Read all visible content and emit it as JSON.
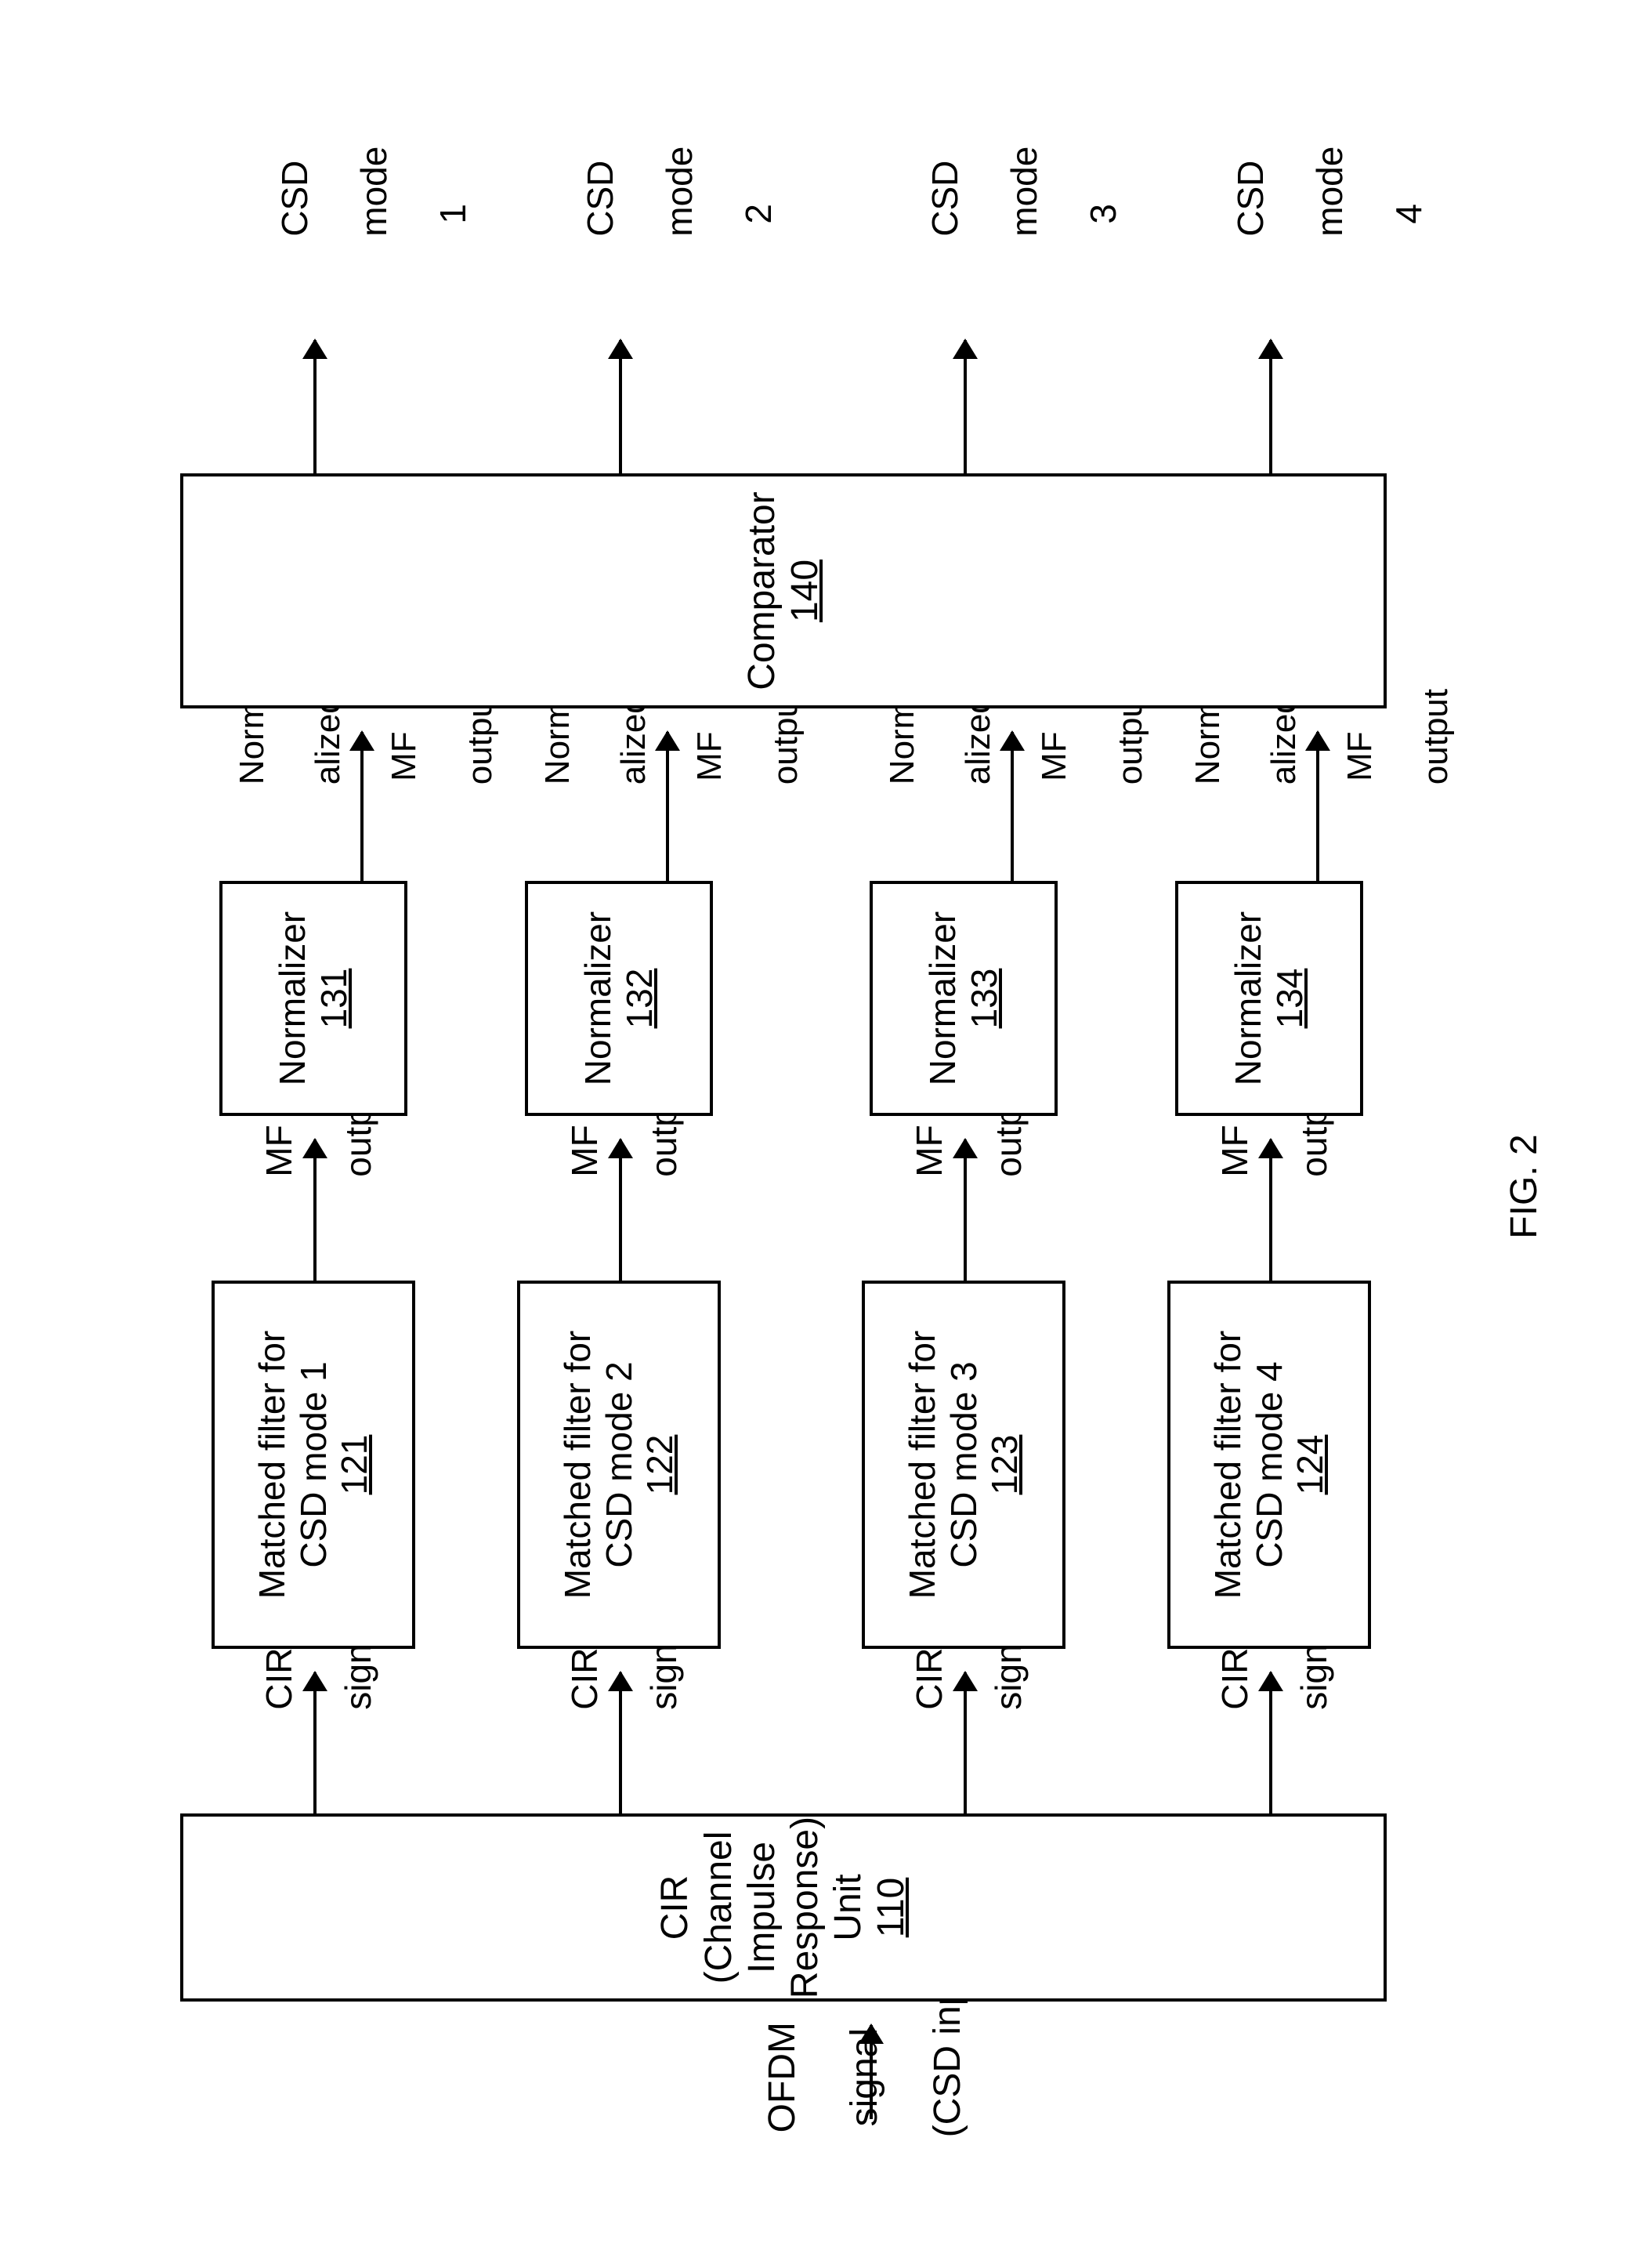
{
  "figure_label": "FIG. 2",
  "input": {
    "line1": "OFDM",
    "line2": "signal",
    "line3": "(CSD input)"
  },
  "cir_unit": {
    "line1": "CIR",
    "line2": "(Channel",
    "line3": "Impulse",
    "line4": "Response)",
    "line5": "Unit",
    "ref": "110"
  },
  "cir_signal": {
    "line1": "CIR",
    "line2": "signal"
  },
  "mf_blocks": [
    {
      "line1": "Matched filter for",
      "line2": "CSD mode 1",
      "ref": "121"
    },
    {
      "line1": "Matched filter for",
      "line2": "CSD mode 2",
      "ref": "122"
    },
    {
      "line1": "Matched filter for",
      "line2": "CSD mode 3",
      "ref": "123"
    },
    {
      "line1": "Matched filter for",
      "line2": "CSD mode 4",
      "ref": "124"
    }
  ],
  "mf_output": {
    "line1": "MF",
    "line2": "output"
  },
  "norm_blocks": [
    {
      "label": "Normalizer",
      "ref": "131"
    },
    {
      "label": "Normalizer",
      "ref": "132"
    },
    {
      "label": "Normalizer",
      "ref": "133"
    },
    {
      "label": "Normalizer",
      "ref": "134"
    }
  ],
  "norm_output": {
    "line1": "Norm-",
    "line2": "alized",
    "line3": "MF",
    "line4": "output"
  },
  "comparator": {
    "label": "Comparator",
    "ref": "140"
  },
  "outputs": [
    {
      "line1": "CSD",
      "line2": "mode",
      "line3": "1"
    },
    {
      "line1": "CSD",
      "line2": "mode",
      "line3": "2"
    },
    {
      "line1": "CSD",
      "line2": "mode",
      "line3": "3"
    },
    {
      "line1": "CSD",
      "line2": "mode",
      "line3": "4"
    }
  ]
}
